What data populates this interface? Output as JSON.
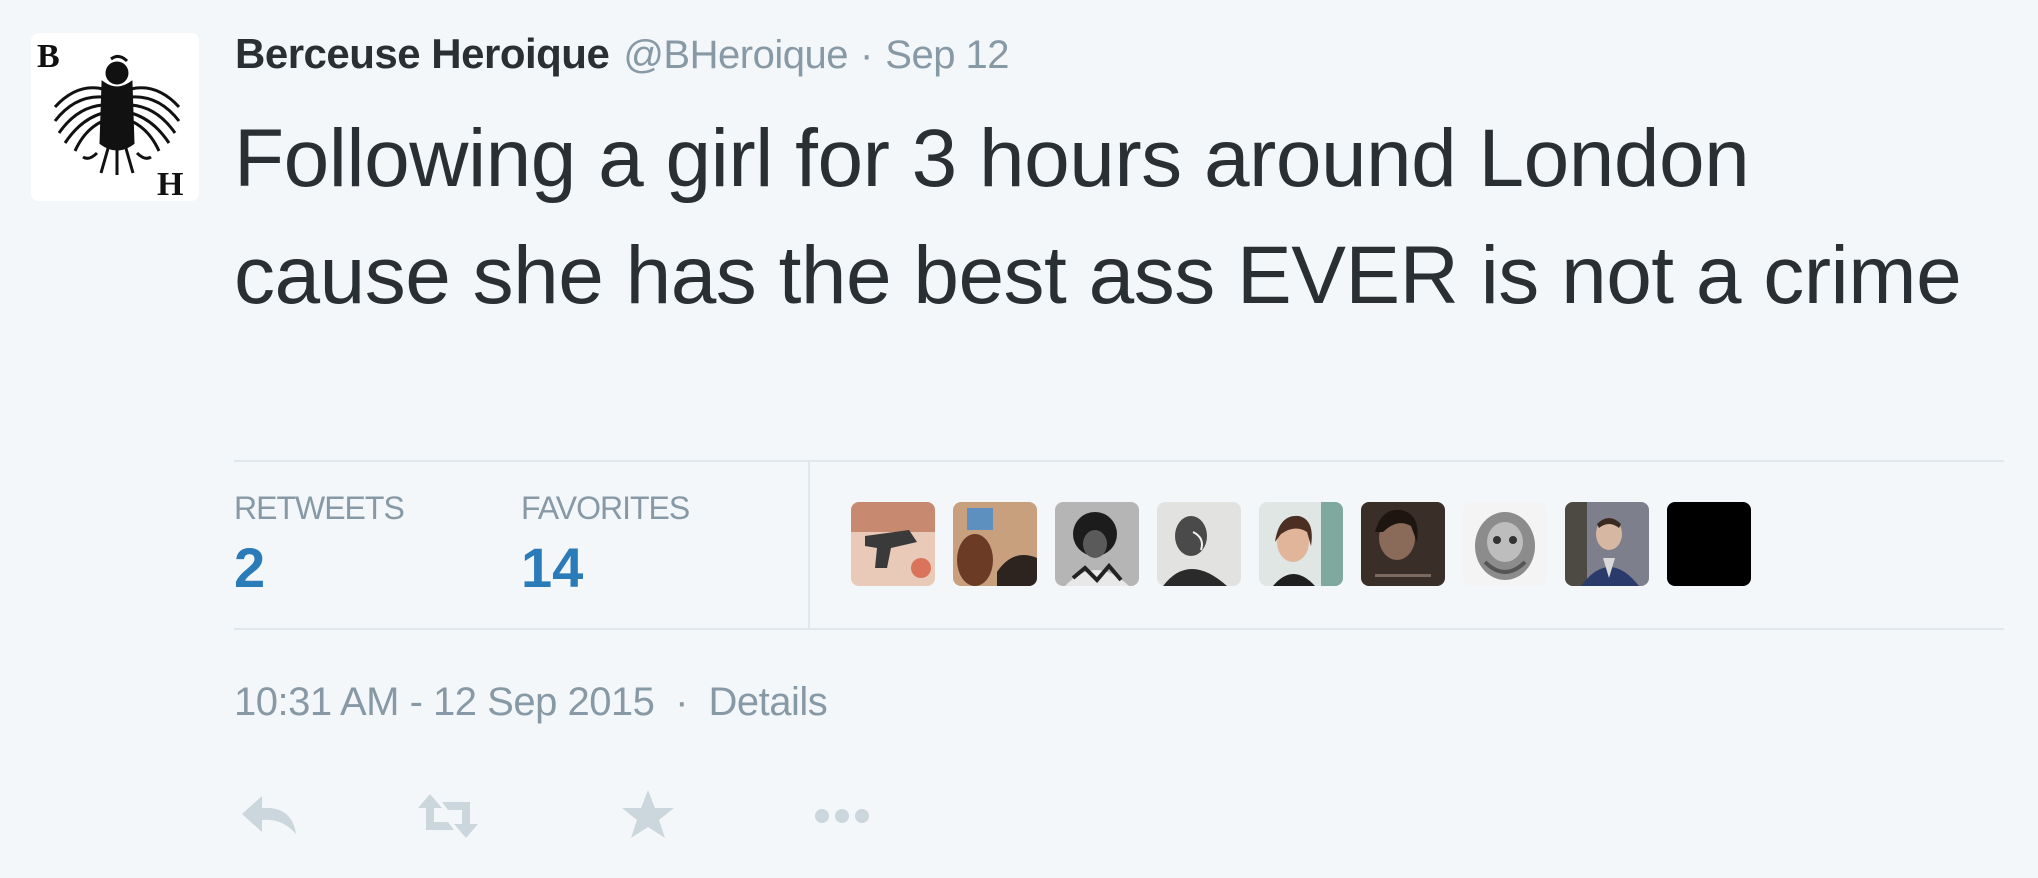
{
  "tweet": {
    "fullname": "Berceuse Heroique",
    "username": "@BHeroique",
    "separator": "·",
    "timestamp": "Sep 12",
    "text": "Following a girl for 3 hours around London cause she has the best ass EVER is not a crime",
    "avatar_letters": {
      "top": "B",
      "bottom": "H"
    }
  },
  "stats": {
    "retweets_label": "RETWEETS",
    "retweets_count": "2",
    "favorites_label": "FAVORITES",
    "favorites_count": "14",
    "favoriter_avatars": [
      "favoriter-avatar-1",
      "favoriter-avatar-2",
      "favoriter-avatar-3",
      "favoriter-avatar-4",
      "favoriter-avatar-5",
      "favoriter-avatar-6",
      "favoriter-avatar-7",
      "favoriter-avatar-8",
      "favoriter-avatar-9"
    ]
  },
  "footer": {
    "datetime": "10:31 AM - 12 Sep 2015",
    "separator": "·",
    "details_label": "Details"
  },
  "actions": [
    "reply-icon",
    "retweet-icon",
    "favorite-star-icon",
    "more-dots-icon"
  ],
  "colors": {
    "background": "#f4f7fa",
    "text": "#292f33",
    "muted": "#8899a6",
    "link_blue": "#2b7bb9",
    "divider": "#e1e8ed",
    "action_icon": "#ccd6dd"
  }
}
